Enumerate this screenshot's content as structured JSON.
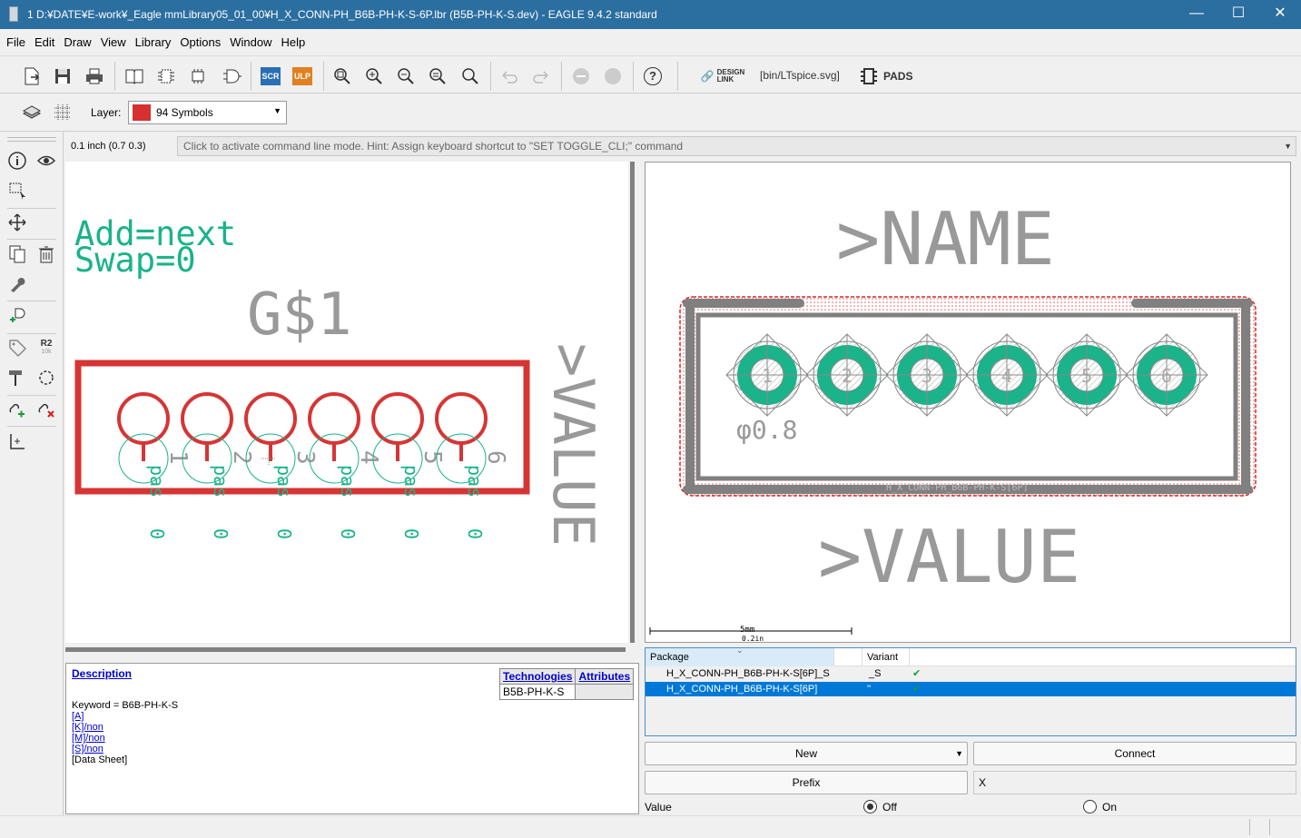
{
  "window": {
    "title": "1 D:¥DATE¥E-work¥_Eagle mmLibrary05_01_00¥H_X_CONN-PH_B6B-PH-K-S-6P.lbr (B5B-PH-K-S.dev) - EAGLE 9.4.2 standard",
    "minimize": "—",
    "maximize": "☐",
    "close": "✕"
  },
  "menu": [
    "File",
    "Edit",
    "Draw",
    "View",
    "Library",
    "Options",
    "Window",
    "Help"
  ],
  "toolbar": {
    "scr_label": "SCR",
    "ulp_label": "ULP",
    "help_label": "?",
    "design_link_label": "DESIGN\nLINK",
    "design_link_line1": "DESIGN",
    "design_link_line2": "LINK",
    "script_path": "[bin/LTspice.svg]",
    "pads_label": "PADS"
  },
  "toolbar2": {
    "layer_label": "Layer:",
    "layer_value": "94 Symbols",
    "layer_color": "#d63030"
  },
  "coordinates": "0.1 inch (0.7 0.3)",
  "command_line_hint": "Click to activate command line mode. Hint: Assign keyboard shortcut to \"SET TOGGLE_CLI;\" command",
  "left_tools": {
    "r2_label": "R2",
    "r2_sub": "10k"
  },
  "schematic": {
    "add_text": "Add=next",
    "swap_text": "Swap=0",
    "gate_name": "G$1",
    "value_text": ">VALUE",
    "pin_numbers": [
      "1",
      "2",
      "3",
      "4",
      "5",
      "6"
    ],
    "pin_label": "pas",
    "pin_swap": "0"
  },
  "package": {
    "name_text": ">NAME",
    "value_text": ">VALUE",
    "drill_text": "φ0.8",
    "pad_numbers": [
      "1",
      "2",
      "3",
      "4",
      "5",
      "6"
    ],
    "package_label": "H_X_CONN-PH_B6B-PH-K-S[6P]",
    "scale_top": "5mm",
    "scale_bottom": "0.2in",
    "outline_color": "#808080",
    "pad_color": "#1ab38a",
    "keepout_color": "#d62828"
  },
  "description": {
    "title": "Description",
    "keyword": "Keyword = B6B-PH-K-S",
    "links": [
      "[A]",
      "[K]/non",
      "[M]/non",
      "[S]/non"
    ],
    "datasheet": "[Data Sheet]",
    "tech_header": "Technologies",
    "attr_header": "Attributes",
    "tech_value": "B5B-PH-K-S"
  },
  "variants": {
    "col_package": "Package",
    "col_variant": "Variant",
    "rows": [
      {
        "package": "H_X_CONN-PH_B6B-PH-K-S[6P]_S",
        "variant": "_S",
        "check": "✔"
      },
      {
        "package": "H_X_CONN-PH_B6B-PH-K-S[6P]",
        "variant": "''",
        "check": "✔"
      }
    ]
  },
  "buttons": {
    "new": "New",
    "connect": "Connect",
    "prefix": "Prefix",
    "prefix_value": "X"
  },
  "value_option": {
    "label": "Value",
    "off": "Off",
    "on": "On",
    "selected": "Off"
  }
}
